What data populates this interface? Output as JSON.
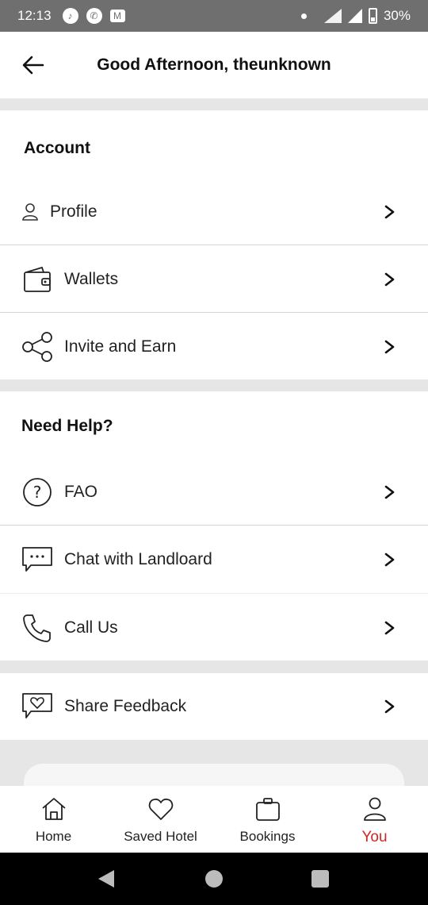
{
  "status": {
    "time": "12:13",
    "battery": "30%"
  },
  "header": {
    "title": "Good Afternoon, theunknown"
  },
  "account": {
    "title": "Account",
    "items": [
      {
        "label": "Profile",
        "icon": "person-icon"
      },
      {
        "label": "Wallets",
        "icon": "wallet-icon"
      },
      {
        "label": "Invite and Earn",
        "icon": "share-icon"
      }
    ]
  },
  "help": {
    "title": "Need Help?",
    "items": [
      {
        "label": "FAO",
        "icon": "question-icon"
      },
      {
        "label": "Chat with Landloard",
        "icon": "chat-icon"
      },
      {
        "label": "Call Us",
        "icon": "phone-icon"
      }
    ]
  },
  "feedback": {
    "label": "Share Feedback",
    "icon": "feedback-icon"
  },
  "nav": {
    "items": [
      {
        "label": "Home",
        "icon": "home-icon"
      },
      {
        "label": "Saved Hotel",
        "icon": "heart-icon"
      },
      {
        "label": "Bookings",
        "icon": "briefcase-icon"
      },
      {
        "label": "You",
        "icon": "person-icon",
        "active": true
      }
    ],
    "active_color": "#d32424"
  }
}
